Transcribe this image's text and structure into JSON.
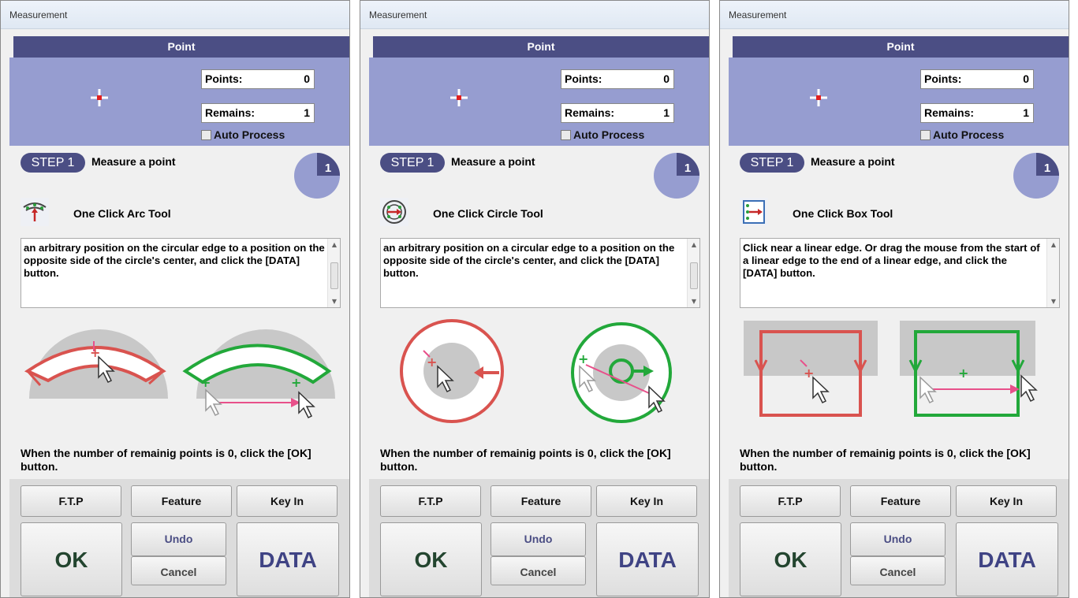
{
  "panels": [
    {
      "window_title": "Measurement",
      "mode": "Point",
      "points_label": "Points:",
      "points_value": "0",
      "remains_label": "Remains:",
      "remains_value": "1",
      "auto_process": "Auto Process",
      "step_badge": "STEP 1",
      "step_text": "Measure a point",
      "step_number": "1",
      "tool_icon": "arc-tool-icon",
      "tool_name": "One Click Arc Tool",
      "description": "an arbitrary position on the circular edge to a position on the opposite side of the circle's center, and click the [DATA] button.",
      "illustration": "arc",
      "bottom_text": "When the number of remainig points is 0, click the [OK] button.",
      "buttons": {
        "ftp": "F.T.P",
        "feature": "Feature",
        "keyin": "Key In",
        "ok": "OK",
        "undo": "Undo",
        "cancel": "Cancel",
        "data": "DATA"
      }
    },
    {
      "window_title": "Measurement",
      "mode": "Point",
      "points_label": "Points:",
      "points_value": "0",
      "remains_label": "Remains:",
      "remains_value": "1",
      "auto_process": "Auto Process",
      "step_badge": "STEP 1",
      "step_text": "Measure a point",
      "step_number": "1",
      "tool_icon": "circle-tool-icon",
      "tool_name": "One Click Circle Tool",
      "description": "an arbitrary position on a circular edge to a position on the opposite side of the circle's center, and click the [DATA] button.",
      "illustration": "circle",
      "bottom_text": "When the number of remainig points is 0, click the [OK] button.",
      "buttons": {
        "ftp": "F.T.P",
        "feature": "Feature",
        "keyin": "Key In",
        "ok": "OK",
        "undo": "Undo",
        "cancel": "Cancel",
        "data": "DATA"
      }
    },
    {
      "window_title": "Measurement",
      "mode": "Point",
      "points_label": "Points:",
      "points_value": "0",
      "remains_label": "Remains:",
      "remains_value": "1",
      "auto_process": "Auto Process",
      "step_badge": "STEP 1",
      "step_text": "Measure a point",
      "step_number": "1",
      "tool_icon": "box-tool-icon",
      "tool_name": "One Click Box Tool",
      "description": "Click near a linear edge. Or drag the mouse from the start of a linear edge to the end of a linear edge, and click the [DATA] button.",
      "illustration": "box",
      "bottom_text": "When the number of remainig points is 0, click the [OK] button.",
      "buttons": {
        "ftp": "F.T.P",
        "feature": "Feature",
        "keyin": "Key In",
        "ok": "OK",
        "undo": "Undo",
        "cancel": "Cancel",
        "data": "DATA"
      }
    }
  ],
  "colors": {
    "mode_bar": "#4b4e84",
    "blue_area": "#969dd0",
    "ok_text": "#23452f",
    "data_text": "#3f4384",
    "red_edge": "#d9534f",
    "green_edge": "#22a83a"
  }
}
